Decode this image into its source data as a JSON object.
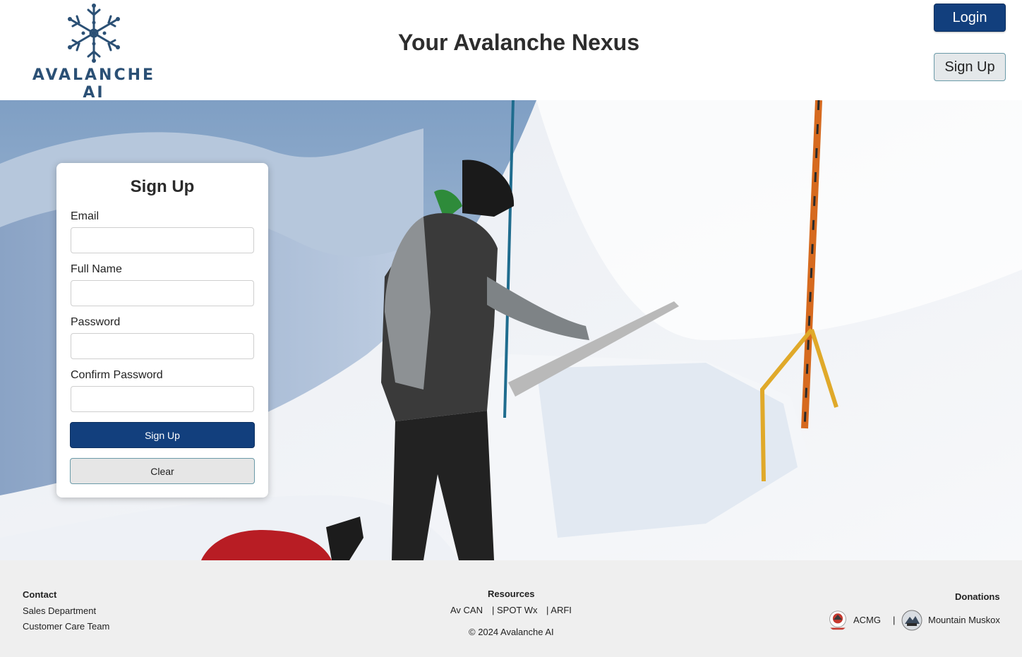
{
  "header": {
    "logo_text": "AVALANCHE AI",
    "title": "Your Avalanche Nexus",
    "login_label": "Login",
    "signup_label": "Sign Up"
  },
  "form": {
    "title": "Sign Up",
    "fields": [
      {
        "label": "Email",
        "value": ""
      },
      {
        "label": "Full Name",
        "value": ""
      },
      {
        "label": "Password",
        "value": ""
      },
      {
        "label": "Confirm Password",
        "value": ""
      }
    ],
    "submit_label": "Sign Up",
    "clear_label": "Clear"
  },
  "footer": {
    "contact": {
      "heading": "Contact",
      "links": [
        "Sales Department",
        "Customer Care Team"
      ]
    },
    "resources": {
      "heading": "Resources",
      "links": [
        "Av CAN",
        "| SPOT Wx",
        "| ARFI"
      ],
      "copyright": "© 2024 Avalanche AI"
    },
    "donations": {
      "heading": "Donations",
      "links": [
        "ACMG",
        "|",
        "Mountain Muskox"
      ]
    }
  },
  "colors": {
    "primary": "#123f7d",
    "logo": "#2b5075",
    "footer_bg": "#efefef"
  }
}
